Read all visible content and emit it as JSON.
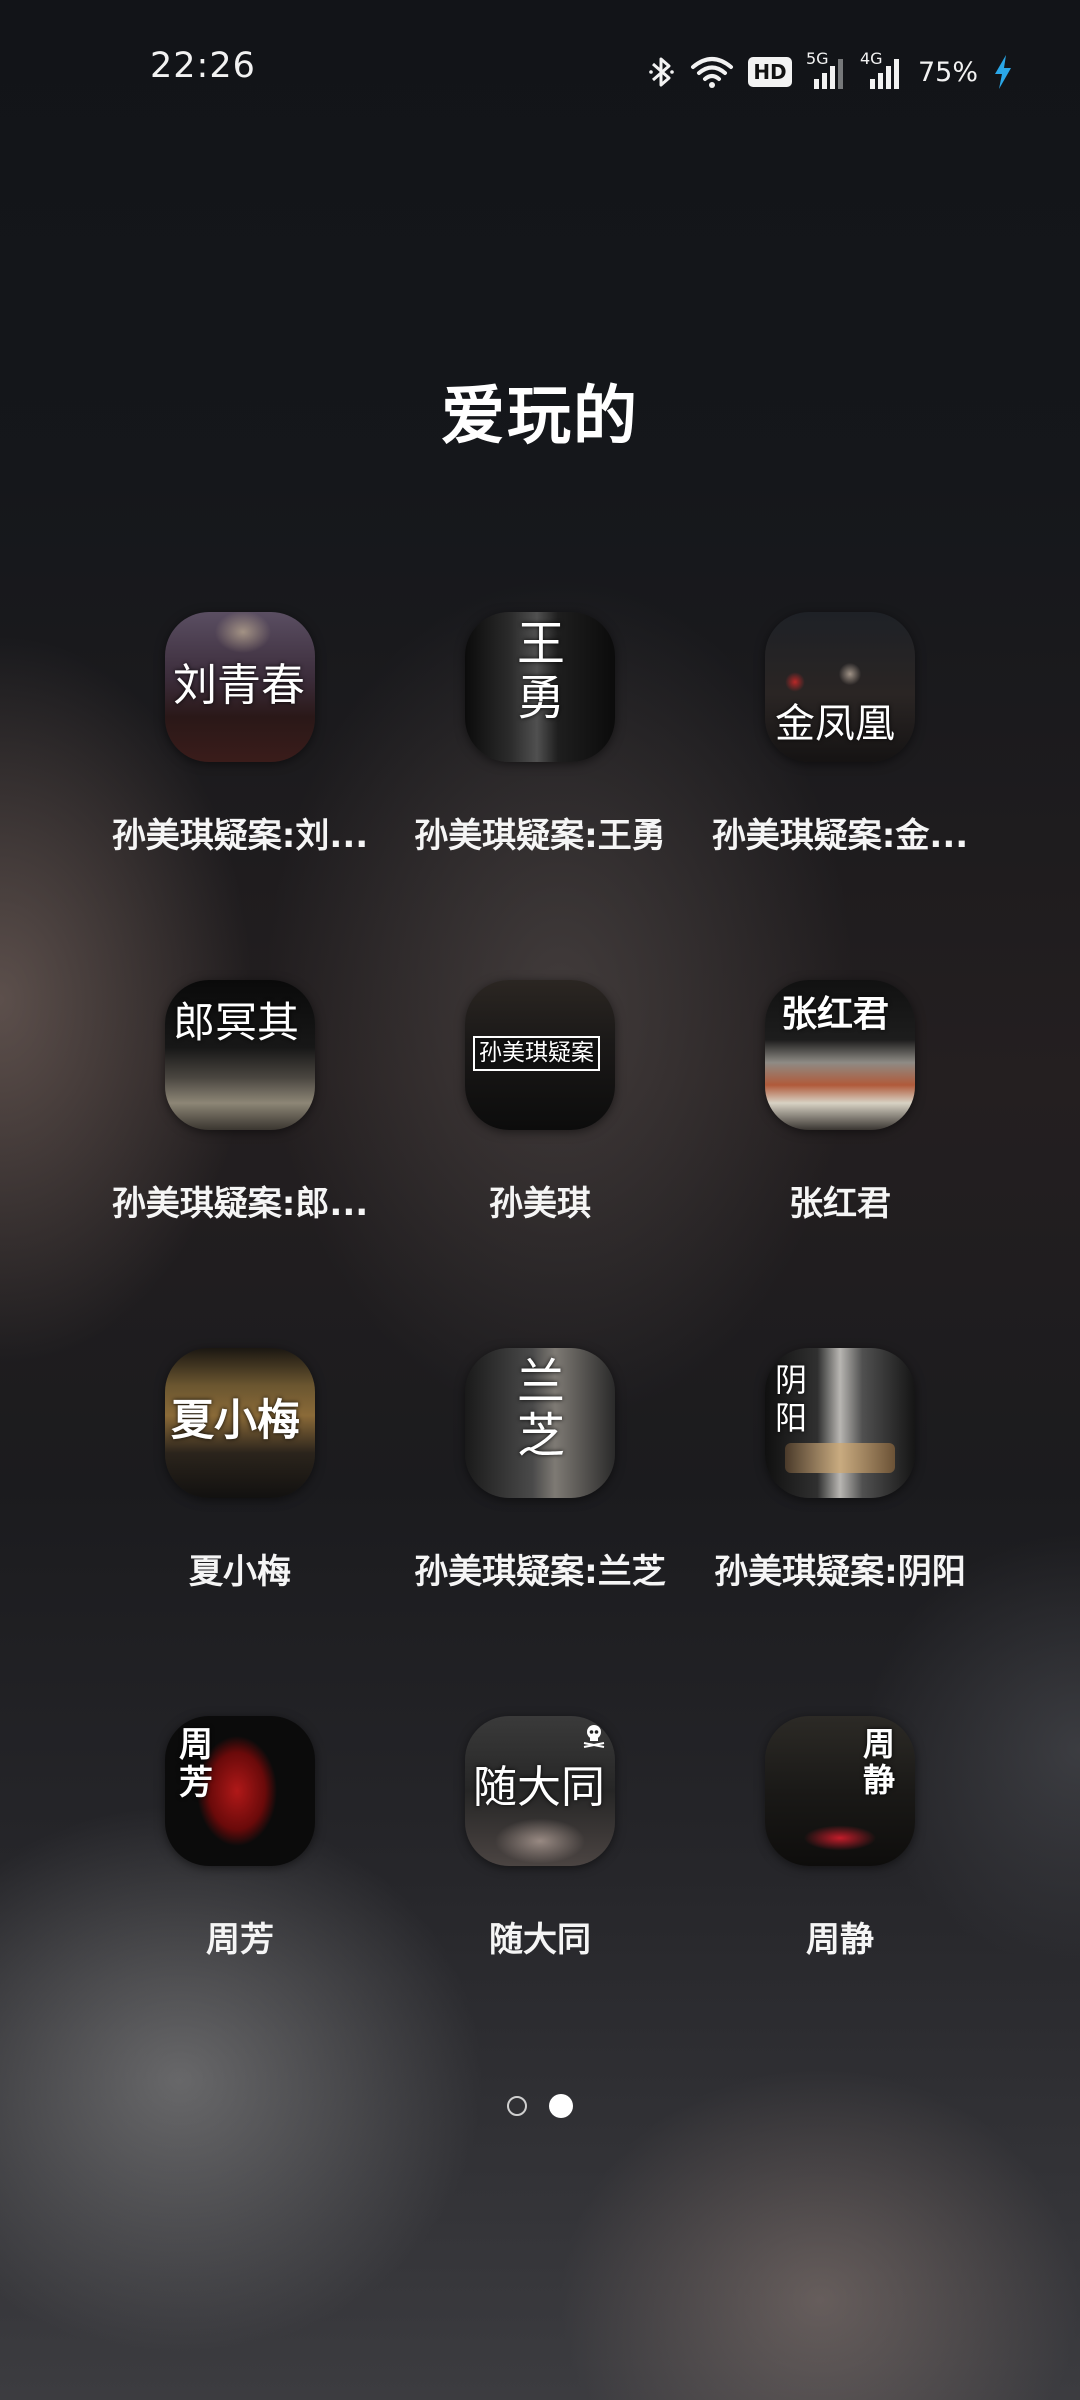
{
  "status_bar": {
    "time": "22:26",
    "icons": [
      "bluetooth-icon",
      "wifi-icon",
      "hd-icon",
      "signal-5g-icon",
      "signal-4g-icon",
      "charging-icon"
    ],
    "hd_label": "HD",
    "network_5g": "5G",
    "network_4g": "4G",
    "battery": "75%"
  },
  "folder": {
    "title": "爱玩的"
  },
  "apps": [
    {
      "label": "孙美琪疑案:刘...",
      "icon_text": "刘青春"
    },
    {
      "label": "孙美琪疑案:王勇",
      "icon_text_1": "王",
      "icon_text_2": "勇"
    },
    {
      "label": "孙美琪疑案:金...",
      "icon_text": "金凤凰"
    },
    {
      "label": "孙美琪疑案:郎...",
      "icon_text": "郎冥其"
    },
    {
      "label": "孙美琪",
      "icon_text": "孙美琪疑案"
    },
    {
      "label": "张红君",
      "icon_text": "张红君"
    },
    {
      "label": "夏小梅",
      "icon_text": "夏小梅"
    },
    {
      "label": "孙美琪疑案:兰芝",
      "icon_text_1": "兰",
      "icon_text_2": "芝"
    },
    {
      "label": "孙美琪疑案:阴阳",
      "icon_text_1": "阴",
      "icon_text_2": "阳"
    },
    {
      "label": "周芳",
      "icon_text_1": "周",
      "icon_text_2": "芳"
    },
    {
      "label": "随大同",
      "icon_text": "随大同"
    },
    {
      "label": "周静",
      "icon_text_1": "周",
      "icon_text_2": "静"
    }
  ],
  "pager": {
    "total": 2,
    "current": 2
  },
  "colors": {
    "charging_bolt": "#2aa7e8",
    "text": "#ffffff"
  }
}
